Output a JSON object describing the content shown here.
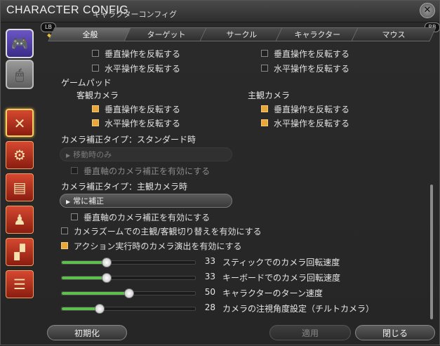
{
  "window": {
    "title_en": "CHARACTER CONFIG",
    "title_jp": "キャラクターコンフィグ"
  },
  "shoulder": {
    "left": "LB",
    "right": "RB"
  },
  "tabs": [
    {
      "label": "全般",
      "active": true
    },
    {
      "label": "ターゲット",
      "active": false
    },
    {
      "label": "サークル",
      "active": false
    },
    {
      "label": "キャラクター",
      "active": false
    },
    {
      "label": "マウス",
      "active": false
    }
  ],
  "content": {
    "top_rows": {
      "left": [
        {
          "label": "垂直操作を反転する",
          "checked": false
        },
        {
          "label": "水平操作を反転する",
          "checked": false
        }
      ],
      "right": [
        {
          "label": "垂直操作を反転する",
          "checked": false
        },
        {
          "label": "水平操作を反転する",
          "checked": false
        }
      ]
    },
    "gamepad_heading": "ゲームパッド",
    "objective_camera": {
      "heading": "客観カメラ",
      "rows": [
        {
          "label": "垂直操作を反転する",
          "checked": true
        },
        {
          "label": "水平操作を反転する",
          "checked": true
        }
      ]
    },
    "subjective_camera": {
      "heading": "主観カメラ",
      "rows": [
        {
          "label": "垂直操作を反転する",
          "checked": true
        },
        {
          "label": "水平操作を反転する",
          "checked": true
        }
      ]
    },
    "standard_assist": {
      "heading": "カメラ補正タイプ：スタンダード時",
      "dropdown": "移動時のみ",
      "vertical_label": "垂直軸のカメラ補正を有効にする",
      "vertical_checked": false
    },
    "subjective_assist": {
      "heading": "カメラ補正タイプ：主観カメラ時",
      "dropdown": "常に補正",
      "vertical_label": "垂直軸のカメラ補正を有効にする",
      "vertical_checked": false
    },
    "zoom_switch": {
      "label": "カメラズームでの主観/客観切り替えを有効にする",
      "checked": false
    },
    "action_camera": {
      "label": "アクション実行時のカメラ演出を有効にする",
      "checked": true
    },
    "sliders": [
      {
        "value": 33,
        "max": 100,
        "label": "スティックでのカメラ回転速度"
      },
      {
        "value": 33,
        "max": 100,
        "label": "キーボードでのカメラ回転速度"
      },
      {
        "value": 50,
        "max": 100,
        "label": "キャラクターのターン速度"
      },
      {
        "value": 28,
        "max": 100,
        "label": "カメラの注視角度設定（チルトカメラ）"
      }
    ]
  },
  "buttons": {
    "reset": "初期化",
    "apply": "適用",
    "close": "閉じる"
  },
  "colors": {
    "accent_check": "#e9a73a",
    "slider_fill": "#5fbf4e",
    "category_selected": "#f6d060"
  },
  "icons": {
    "sidebar": [
      "gamepad-icon",
      "mouse-icon",
      "camera-control-icon",
      "gear-bag-icon",
      "id-card-icon",
      "character-icon",
      "checker-icon",
      "chat-bubble-icon"
    ],
    "close": "close-icon"
  }
}
